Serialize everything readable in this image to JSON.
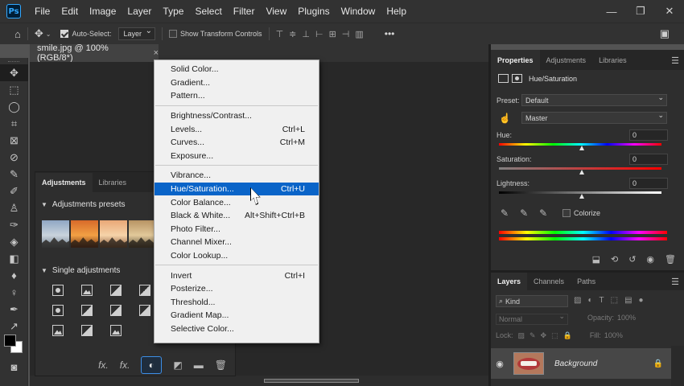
{
  "menubar": {
    "logo": "Ps",
    "items": [
      "File",
      "Edit",
      "Image",
      "Layer",
      "Type",
      "Select",
      "Filter",
      "View",
      "Plugins",
      "Window",
      "Help"
    ]
  },
  "options_bar": {
    "auto_select_label": "Auto-Select:",
    "auto_select_checked": true,
    "auto_select_target": "Layer",
    "show_transform_label": "Show Transform Controls",
    "show_transform_checked": false,
    "more_label": "•••"
  },
  "document": {
    "tab_title": "smile.jpg @ 100% (RGB/8*)",
    "close_glyph": "×"
  },
  "adjustments_panel": {
    "tabs": [
      "Adjustments",
      "Libraries"
    ],
    "active_tab": "Adjustments",
    "presets_heading": "Adjustments presets",
    "single_heading": "Single adjustments"
  },
  "dropdown": {
    "groups": [
      [
        {
          "label": "Solid Color...",
          "shortcut": ""
        },
        {
          "label": "Gradient...",
          "shortcut": ""
        },
        {
          "label": "Pattern...",
          "shortcut": ""
        }
      ],
      [
        {
          "label": "Brightness/Contrast...",
          "shortcut": ""
        },
        {
          "label": "Levels...",
          "shortcut": "Ctrl+L"
        },
        {
          "label": "Curves...",
          "shortcut": "Ctrl+M"
        },
        {
          "label": "Exposure...",
          "shortcut": ""
        }
      ],
      [
        {
          "label": "Vibrance...",
          "shortcut": ""
        },
        {
          "label": "Hue/Saturation...",
          "shortcut": "Ctrl+U"
        },
        {
          "label": "Color Balance...",
          "shortcut": ""
        },
        {
          "label": "Black & White...",
          "shortcut": "Alt+Shift+Ctrl+B"
        },
        {
          "label": "Photo Filter...",
          "shortcut": ""
        },
        {
          "label": "Channel Mixer...",
          "shortcut": ""
        },
        {
          "label": "Color Lookup...",
          "shortcut": ""
        }
      ],
      [
        {
          "label": "Invert",
          "shortcut": "Ctrl+I"
        },
        {
          "label": "Posterize...",
          "shortcut": ""
        },
        {
          "label": "Threshold...",
          "shortcut": ""
        },
        {
          "label": "Gradient Map...",
          "shortcut": ""
        },
        {
          "label": "Selective Color...",
          "shortcut": ""
        }
      ]
    ],
    "highlighted": "Hue/Saturation...",
    "highlight_color": "#0a64c8"
  },
  "properties": {
    "tabs": [
      "Properties",
      "Adjustments",
      "Libraries"
    ],
    "active_tab": "Properties",
    "title": "Hue/Saturation",
    "preset_label": "Preset:",
    "preset_value": "Default",
    "channel_value": "Master",
    "hue_label": "Hue:",
    "hue_value": "0",
    "saturation_label": "Saturation:",
    "saturation_value": "0",
    "lightness_label": "Lightness:",
    "lightness_value": "0",
    "colorize_label": "Colorize",
    "colorize_checked": false
  },
  "layers_panel": {
    "tabs": [
      "Layers",
      "Channels",
      "Paths"
    ],
    "active_tab": "Layers",
    "filter_label": "Kind",
    "blend_mode": "Normal",
    "opacity_label": "Opacity:",
    "opacity_value": "100%",
    "lock_label": "Lock:",
    "fill_label": "Fill:",
    "fill_value": "100%",
    "layer_name": "Background"
  }
}
